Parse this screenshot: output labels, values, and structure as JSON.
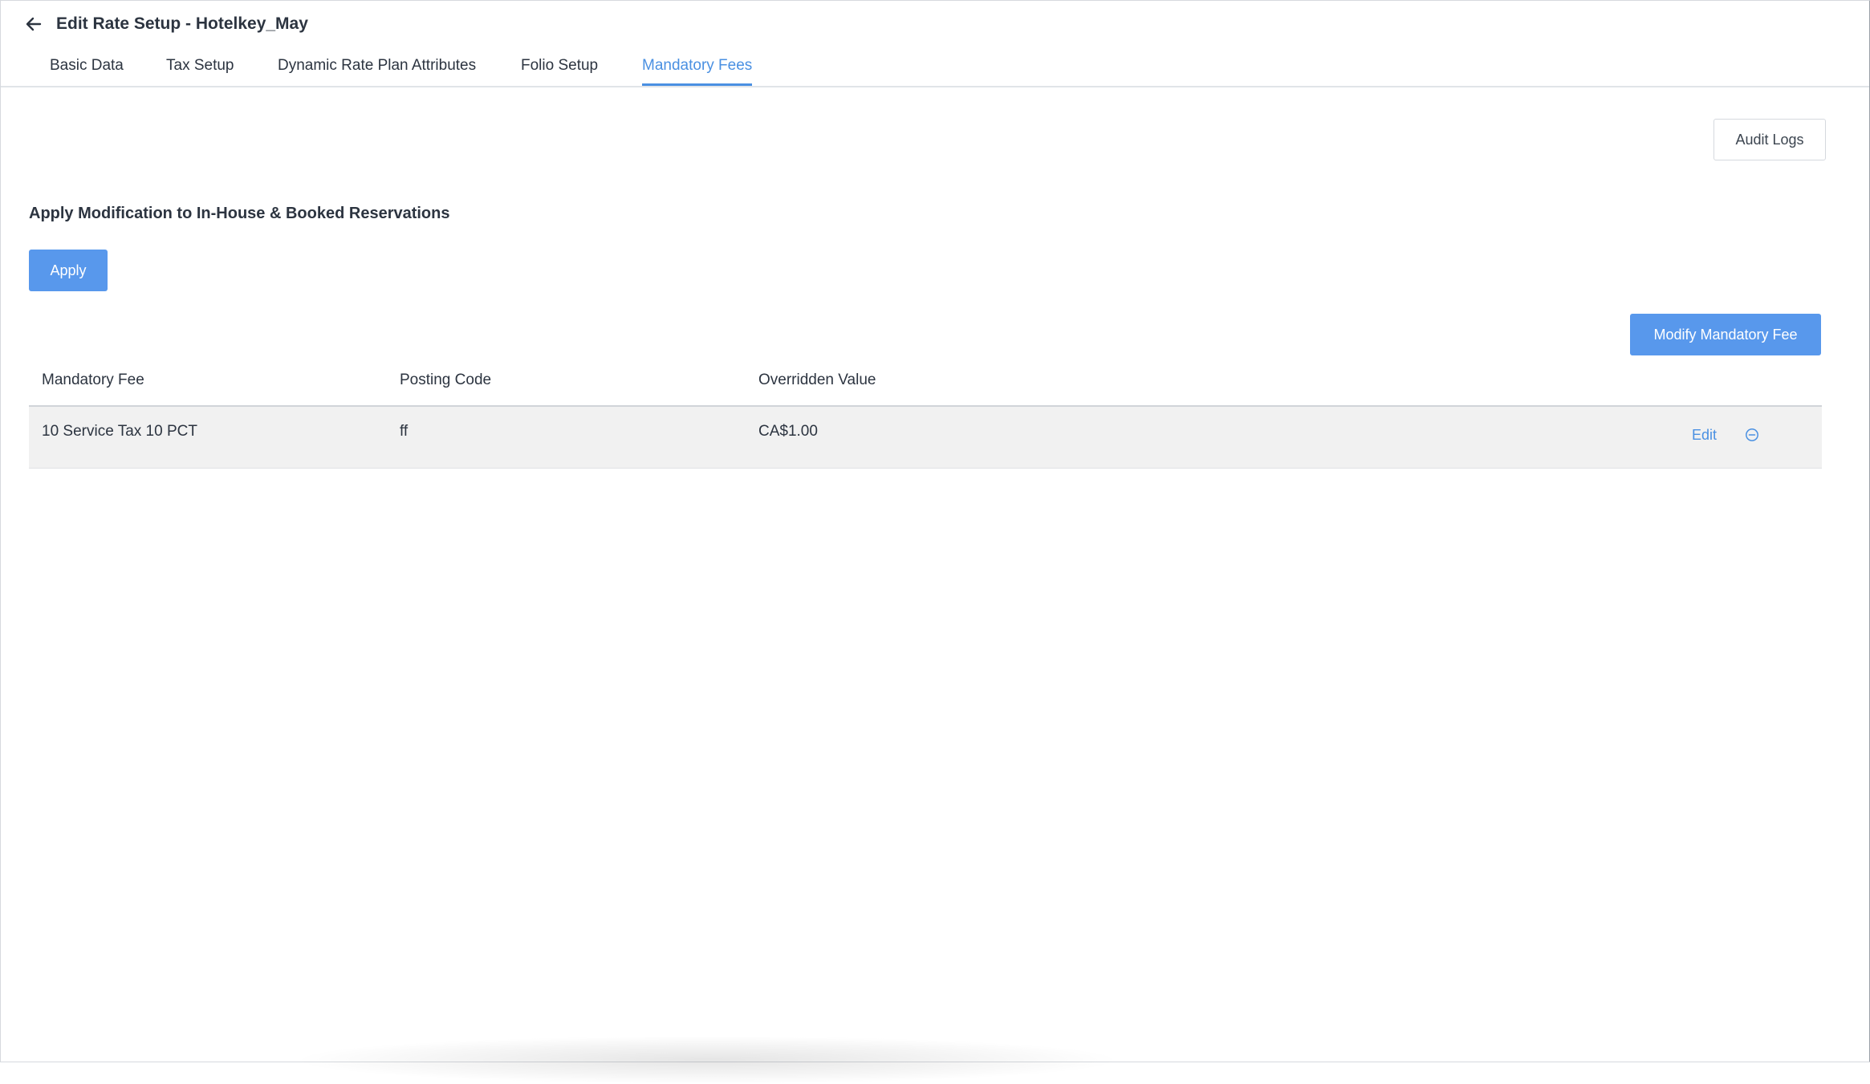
{
  "header": {
    "title": "Edit Rate Setup - Hotelkey_May",
    "back_icon": "arrow-left-icon"
  },
  "tabs": [
    {
      "label": "Basic Data",
      "active": false
    },
    {
      "label": "Tax Setup",
      "active": false
    },
    {
      "label": "Dynamic Rate Plan Attributes",
      "active": false
    },
    {
      "label": "Folio Setup",
      "active": false
    },
    {
      "label": "Mandatory Fees",
      "active": true
    }
  ],
  "toolbar": {
    "audit_logs_label": "Audit Logs"
  },
  "apply_section": {
    "heading": "Apply Modification to In-House & Booked Reservations",
    "apply_label": "Apply"
  },
  "fees": {
    "modify_label": "Modify Mandatory Fee",
    "columns": [
      "Mandatory Fee",
      "Posting Code",
      "Overridden Value"
    ],
    "rows": [
      {
        "mandatory_fee": "10 Service Tax 10 PCT",
        "posting_code": "ff",
        "overridden_value": "CA$1.00",
        "edit_label": "Edit",
        "remove_icon": "minus-circle-icon"
      }
    ]
  },
  "colors": {
    "accent": "#4a90e2",
    "primary_button": "#5898ec",
    "row_background": "#f1f1f1"
  }
}
